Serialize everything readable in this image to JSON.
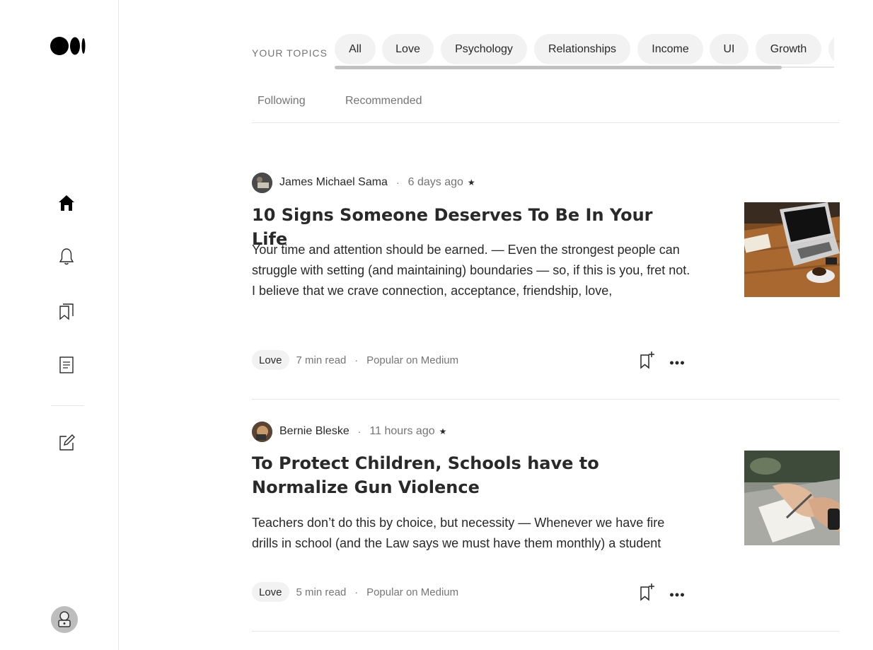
{
  "sidebar": {
    "logo": "medium-logo",
    "nav": [
      {
        "name": "home-icon"
      },
      {
        "name": "bell-icon"
      },
      {
        "name": "bookmarks-icon"
      },
      {
        "name": "stories-icon"
      },
      {
        "name": "write-icon"
      }
    ]
  },
  "topics": {
    "label": "YOUR TOPICS",
    "pills": [
      "All",
      "Love",
      "Psychology",
      "Relationships",
      "Income",
      "UI",
      "Growth"
    ]
  },
  "feed_tabs": {
    "following": "Following",
    "recommended": "Recommended"
  },
  "articles": [
    {
      "author": "James Michael Sama",
      "time_ago": "6 days ago",
      "star": "★",
      "title": "10 Signs Someone Deserves To Be In Your Life",
      "excerpt": "Your time and attention should be earned. — Even the strongest people can struggle with setting (and maintaining) boundaries — so, if this is you, fret not. I believe that we crave connection, acceptance, friendship, love,",
      "tag": "Love",
      "read_time": "7 min read",
      "popular": "Popular on Medium"
    },
    {
      "author": "Bernie Bleske",
      "time_ago": "11 hours ago",
      "star": "★",
      "title": "To Protect Children, Schools have to Normalize Gun Violence",
      "excerpt": "Teachers don’t do this by choice, but necessity — Whenever we have fire drills in school (and the Law says we must have them monthly) a student",
      "tag": "Love",
      "read_time": "5 min read",
      "popular": "Popular on Medium"
    }
  ],
  "separator": "·"
}
